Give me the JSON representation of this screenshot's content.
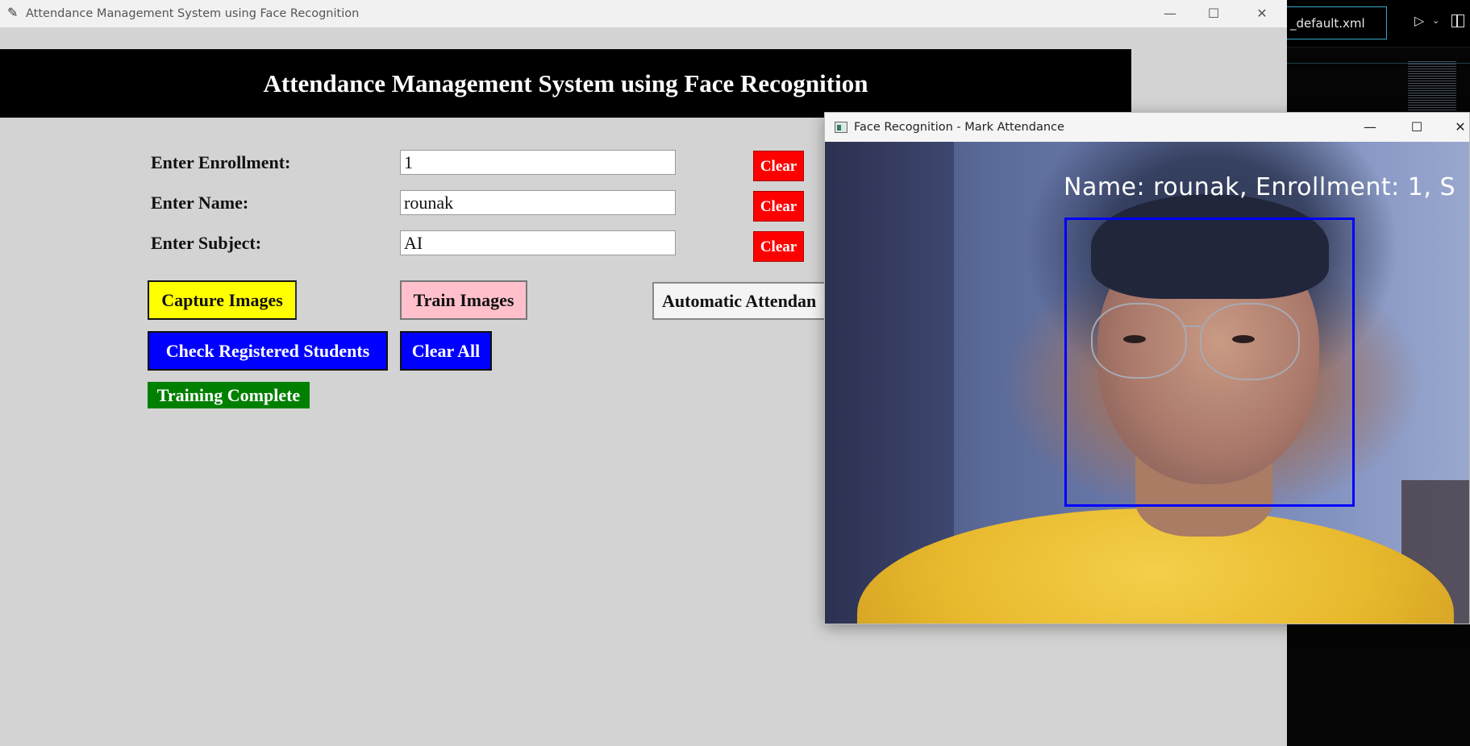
{
  "main_window": {
    "title": "Attendance Management System using Face Recognition",
    "header": "Attendance Management System using Face Recognition",
    "controls": {
      "minimize": "—",
      "maximize": "☐",
      "close": "✕"
    }
  },
  "form": {
    "enrollment": {
      "label": "Enter Enrollment:",
      "value": "1",
      "clear_label": "Clear"
    },
    "name": {
      "label": "Enter Name:",
      "value": "rounak",
      "clear_label": "Clear"
    },
    "subject": {
      "label": "Enter Subject:",
      "value": "AI",
      "clear_label": "Clear"
    }
  },
  "buttons": {
    "capture_images": "Capture Images",
    "train_images": "Train Images",
    "automatic_attendance": "Automatic Attendan",
    "check_registered_students": "Check Registered Students",
    "clear_all": "Clear All"
  },
  "status": {
    "text": "Training Complete",
    "color": "#008000"
  },
  "face_window": {
    "title": "Face Recognition - Mark Attendance",
    "overlay_text": "Name: rounak, Enrollment: 1, S",
    "box_color": "#0000ff",
    "controls": {
      "minimize": "—",
      "maximize": "☐",
      "close": "✕"
    }
  },
  "editor": {
    "tab_label": "_default.xml"
  },
  "colors": {
    "header_bg": "#000000",
    "clear_button": "#ff0000",
    "capture_button": "#ffff00",
    "train_button": "#ffc0cb",
    "blue_buttons": "#0000ff",
    "window_bg": "#d3d3d3"
  }
}
